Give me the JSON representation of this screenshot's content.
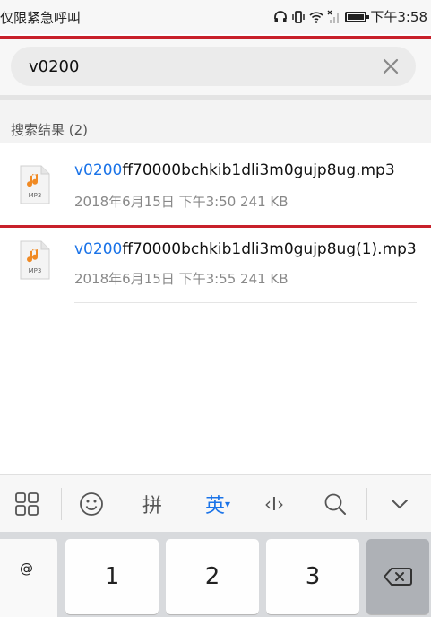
{
  "status_bar": {
    "carrier": "仅限紧急呼叫",
    "time": "下午3:58",
    "icons": [
      "headphones-icon",
      "vibrate-icon",
      "wifi-icon",
      "no-signal-icon",
      "battery-icon"
    ]
  },
  "search": {
    "value": "v0200",
    "clear_icon": "close-icon"
  },
  "results": {
    "header": "搜索结果 (2)",
    "items": [
      {
        "highlight": "v0200",
        "rest": "ff70000bchkib1dli3m0gujp8ug.mp3",
        "meta": "2018年6月15日 下午3:50 241 KB",
        "icon_label": "MP3"
      },
      {
        "highlight": "v0200",
        "rest": "ff70000bchkib1dli3m0gujp8ug(1).mp3",
        "meta": "2018年6月15日 下午3:55 241 KB",
        "icon_label": "MP3"
      }
    ]
  },
  "keyboard": {
    "toolbar": {
      "pinyin": "拼",
      "english": "英",
      "english_arrow": "▾",
      "cursor_symbol": "‹I›"
    },
    "symbol_key": "@",
    "keys": [
      "1",
      "2",
      "3"
    ]
  },
  "colors": {
    "accent": "#1a73e8",
    "red_line": "#c8202a",
    "music_note": "#f08a24"
  }
}
